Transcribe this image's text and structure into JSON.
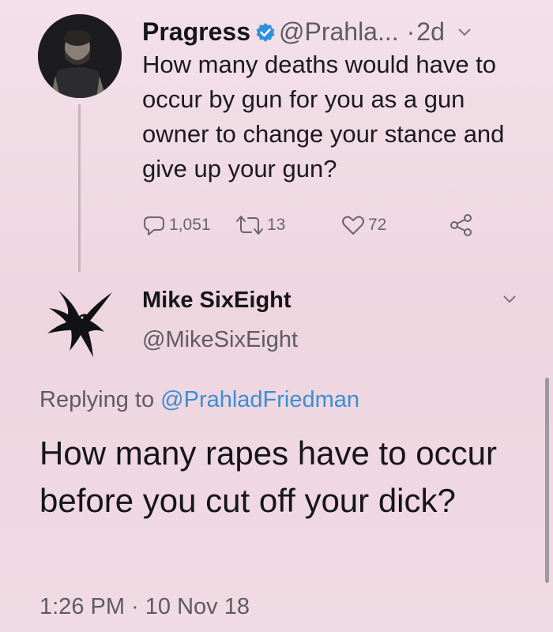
{
  "tweet1": {
    "name": "Pragress",
    "handle": "@Prahla...",
    "dot": "·",
    "time": "2d",
    "body": "How many deaths would have to occur by gun for you as a gun owner to change your stance and give up your gun?",
    "replies": "1,051",
    "retweets": "13",
    "likes": "72",
    "icons": {
      "verified": "verified-badge-icon",
      "menu": "chevron-down-icon",
      "reply": "reply-icon",
      "retweet": "retweet-icon",
      "like": "heart-icon",
      "share": "share-icon"
    },
    "colors": {
      "verified": "#2f8fe0"
    }
  },
  "tweet2": {
    "name": "Mike SixEight",
    "handle": "@MikeSixEight",
    "replying_prefix": "Replying to ",
    "replying_to": "@PrahladFriedman",
    "body": "How many rapes have to occur before you cut off your dick?",
    "timestamp": "1:26 PM · 10 Nov 18",
    "colors": {
      "mention": "#3b8ed4"
    }
  }
}
